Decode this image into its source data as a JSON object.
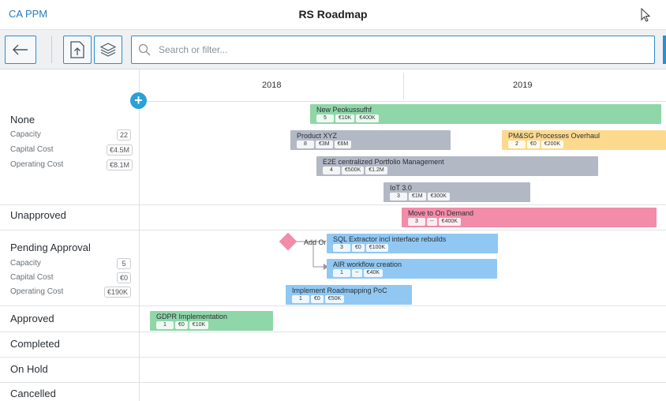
{
  "header": {
    "app_title": "CA PPM",
    "page_title": "RS Roadmap"
  },
  "toolbar": {
    "back_icon": "arrow-left-icon",
    "export_icon": "export-icon",
    "layers_icon": "layers-icon",
    "search_placeholder": "Search or filter...",
    "search_value": ""
  },
  "timeline": {
    "years": [
      "2018",
      "2019"
    ]
  },
  "groups": {
    "none": {
      "title": "None",
      "metrics": [
        {
          "label": "Capacity",
          "value": "22"
        },
        {
          "label": "Capital Cost",
          "value": "€4.5M"
        },
        {
          "label": "Operating Cost",
          "value": "€8.1M"
        }
      ]
    },
    "unapproved": {
      "title": "Unapproved"
    },
    "pending": {
      "title": "Pending Approval",
      "metrics": [
        {
          "label": "Capacity",
          "value": "5"
        },
        {
          "label": "Capital Cost",
          "value": "€0"
        },
        {
          "label": "Operating Cost",
          "value": "€190K"
        }
      ]
    },
    "approved": {
      "title": "Approved"
    },
    "completed": {
      "title": "Completed"
    },
    "onhold": {
      "title": "On Hold"
    },
    "cancelled": {
      "title": "Cancelled"
    }
  },
  "items": [
    {
      "name": "New Peokussufhf",
      "chips": [
        "5",
        "€10K",
        "€400K"
      ],
      "color": "#8fd6a8"
    },
    {
      "name": "Product XYZ",
      "chips": [
        "8",
        "€3M",
        "€6M"
      ],
      "color": "#b3b8c5"
    },
    {
      "name": "PM&SG Processes Overhaul",
      "chips": [
        "2",
        "€0",
        "€200K"
      ],
      "color": "#fdd98d"
    },
    {
      "name": "E2E centralized Portfolio Management",
      "chips": [
        "4",
        "€500K",
        "€1.2M"
      ],
      "color": "#b3b8c5"
    },
    {
      "name": "IoT 3.0",
      "chips": [
        "3",
        "€1M",
        "€300K"
      ],
      "color": "#b3b8c5"
    },
    {
      "name": "Move to On Demand",
      "chips": [
        "3",
        "--",
        "€400K"
      ],
      "color": "#f28ca8"
    },
    {
      "name": "SQL Extractor incl interface rebuilds",
      "chips": [
        "3",
        "€0",
        "€100K"
      ],
      "color": "#90c8f3"
    },
    {
      "name": "AIR workflow creation",
      "chips": [
        "1",
        "--",
        "€40K"
      ],
      "color": "#90c8f3"
    },
    {
      "name": "Implement Roadmapping PoC",
      "chips": [
        "1",
        "€0",
        "€50K"
      ],
      "color": "#90c8f3"
    },
    {
      "name": "GDPR Implementation",
      "chips": [
        "1",
        "€0",
        "€10K"
      ],
      "color": "#8fd6a8"
    }
  ],
  "milestone": {
    "label": "Add Or",
    "color": "#f28ca8"
  }
}
